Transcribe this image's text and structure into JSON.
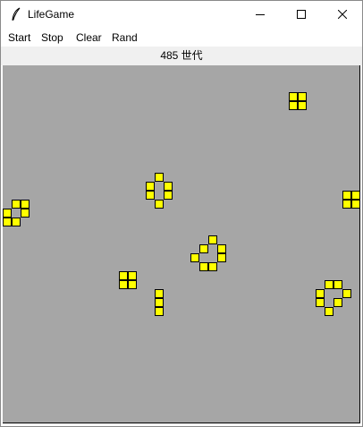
{
  "window": {
    "title": "LifeGame",
    "icon": "feather-icon",
    "controls": [
      "minimize-icon",
      "maximize-icon",
      "close-icon"
    ]
  },
  "menu": {
    "items": [
      {
        "label": "Start"
      },
      {
        "label": "Stop"
      },
      {
        "label": "Clear"
      },
      {
        "label": "Rand"
      }
    ]
  },
  "status": {
    "generation_text": "485 世代"
  },
  "board": {
    "background_color": "#a6a6a6",
    "cell_color": "#ffff00",
    "cell_border_color": "#000000",
    "live_cells": [
      [
        32,
        3
      ],
      [
        33,
        3
      ],
      [
        32,
        4
      ],
      [
        33,
        4
      ],
      [
        17,
        12
      ],
      [
        16,
        13
      ],
      [
        18,
        13
      ],
      [
        16,
        14
      ],
      [
        18,
        14
      ],
      [
        17,
        15
      ],
      [
        38,
        14
      ],
      [
        39,
        14
      ],
      [
        38,
        15
      ],
      [
        39,
        15
      ],
      [
        1,
        15
      ],
      [
        2,
        15
      ],
      [
        0,
        16
      ],
      [
        2,
        16
      ],
      [
        0,
        17
      ],
      [
        1,
        17
      ],
      [
        23,
        19
      ],
      [
        22,
        20
      ],
      [
        24,
        20
      ],
      [
        21,
        21
      ],
      [
        24,
        21
      ],
      [
        22,
        22
      ],
      [
        23,
        22
      ],
      [
        13,
        23
      ],
      [
        14,
        23
      ],
      [
        13,
        24
      ],
      [
        14,
        24
      ],
      [
        17,
        25
      ],
      [
        17,
        26
      ],
      [
        17,
        27
      ],
      [
        36,
        24
      ],
      [
        37,
        24
      ],
      [
        35,
        25
      ],
      [
        38,
        25
      ],
      [
        35,
        26
      ],
      [
        37,
        26
      ],
      [
        36,
        27
      ]
    ]
  }
}
